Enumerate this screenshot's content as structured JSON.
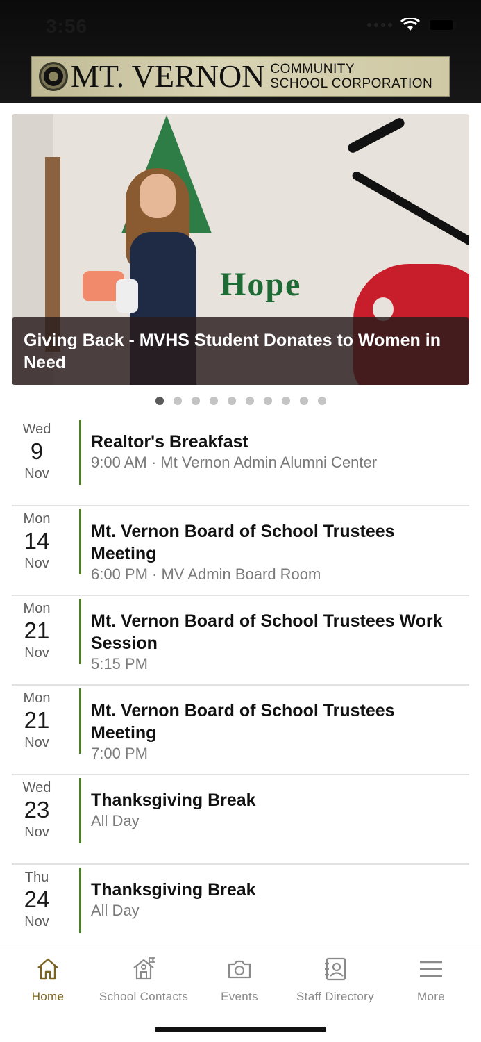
{
  "status_bar": {
    "time": "3:56"
  },
  "header": {
    "logo_main": "MT. VERNON",
    "logo_sub_line1": "COMMUNITY",
    "logo_sub_line2": "SCHOOL CORPORATION"
  },
  "hero": {
    "caption": "Giving Back - MVHS Student Donates to Women in Need",
    "wall_text": "Hope",
    "slide_count": 10,
    "active_slide": 1
  },
  "events": [
    {
      "dow": "Wed",
      "day": "9",
      "mon": "Nov",
      "title": "Realtor's Breakfast",
      "meta": "9:00 AM · Mt Vernon Admin Alumni Center"
    },
    {
      "dow": "Mon",
      "day": "14",
      "mon": "Nov",
      "title": "Mt. Vernon Board of School Trustees Meeting",
      "meta": "6:00 PM · MV Admin Board Room"
    },
    {
      "dow": "Mon",
      "day": "21",
      "mon": "Nov",
      "title": "Mt. Vernon Board of School Trustees Work Session",
      "meta": "5:15 PM"
    },
    {
      "dow": "Mon",
      "day": "21",
      "mon": "Nov",
      "title": "Mt. Vernon Board of School Trustees Meeting",
      "meta": "7:00 PM"
    },
    {
      "dow": "Wed",
      "day": "23",
      "mon": "Nov",
      "title": "Thanksgiving Break",
      "meta": "All Day"
    },
    {
      "dow": "Thu",
      "day": "24",
      "mon": "Nov",
      "title": "Thanksgiving Break",
      "meta": "All Day"
    }
  ],
  "tabbar": {
    "items": [
      {
        "label": "Home",
        "icon": "home-icon",
        "active": true
      },
      {
        "label": "School Contacts",
        "icon": "school-icon",
        "active": false
      },
      {
        "label": "Events",
        "icon": "camera-icon",
        "active": false
      },
      {
        "label": "Staff Directory",
        "icon": "contact-card-icon",
        "active": false
      },
      {
        "label": "More",
        "icon": "menu-icon",
        "active": false
      }
    ]
  },
  "colors": {
    "accent": "#7a6320",
    "event_bar": "#4e7d2a",
    "header_bg": "#111111"
  }
}
